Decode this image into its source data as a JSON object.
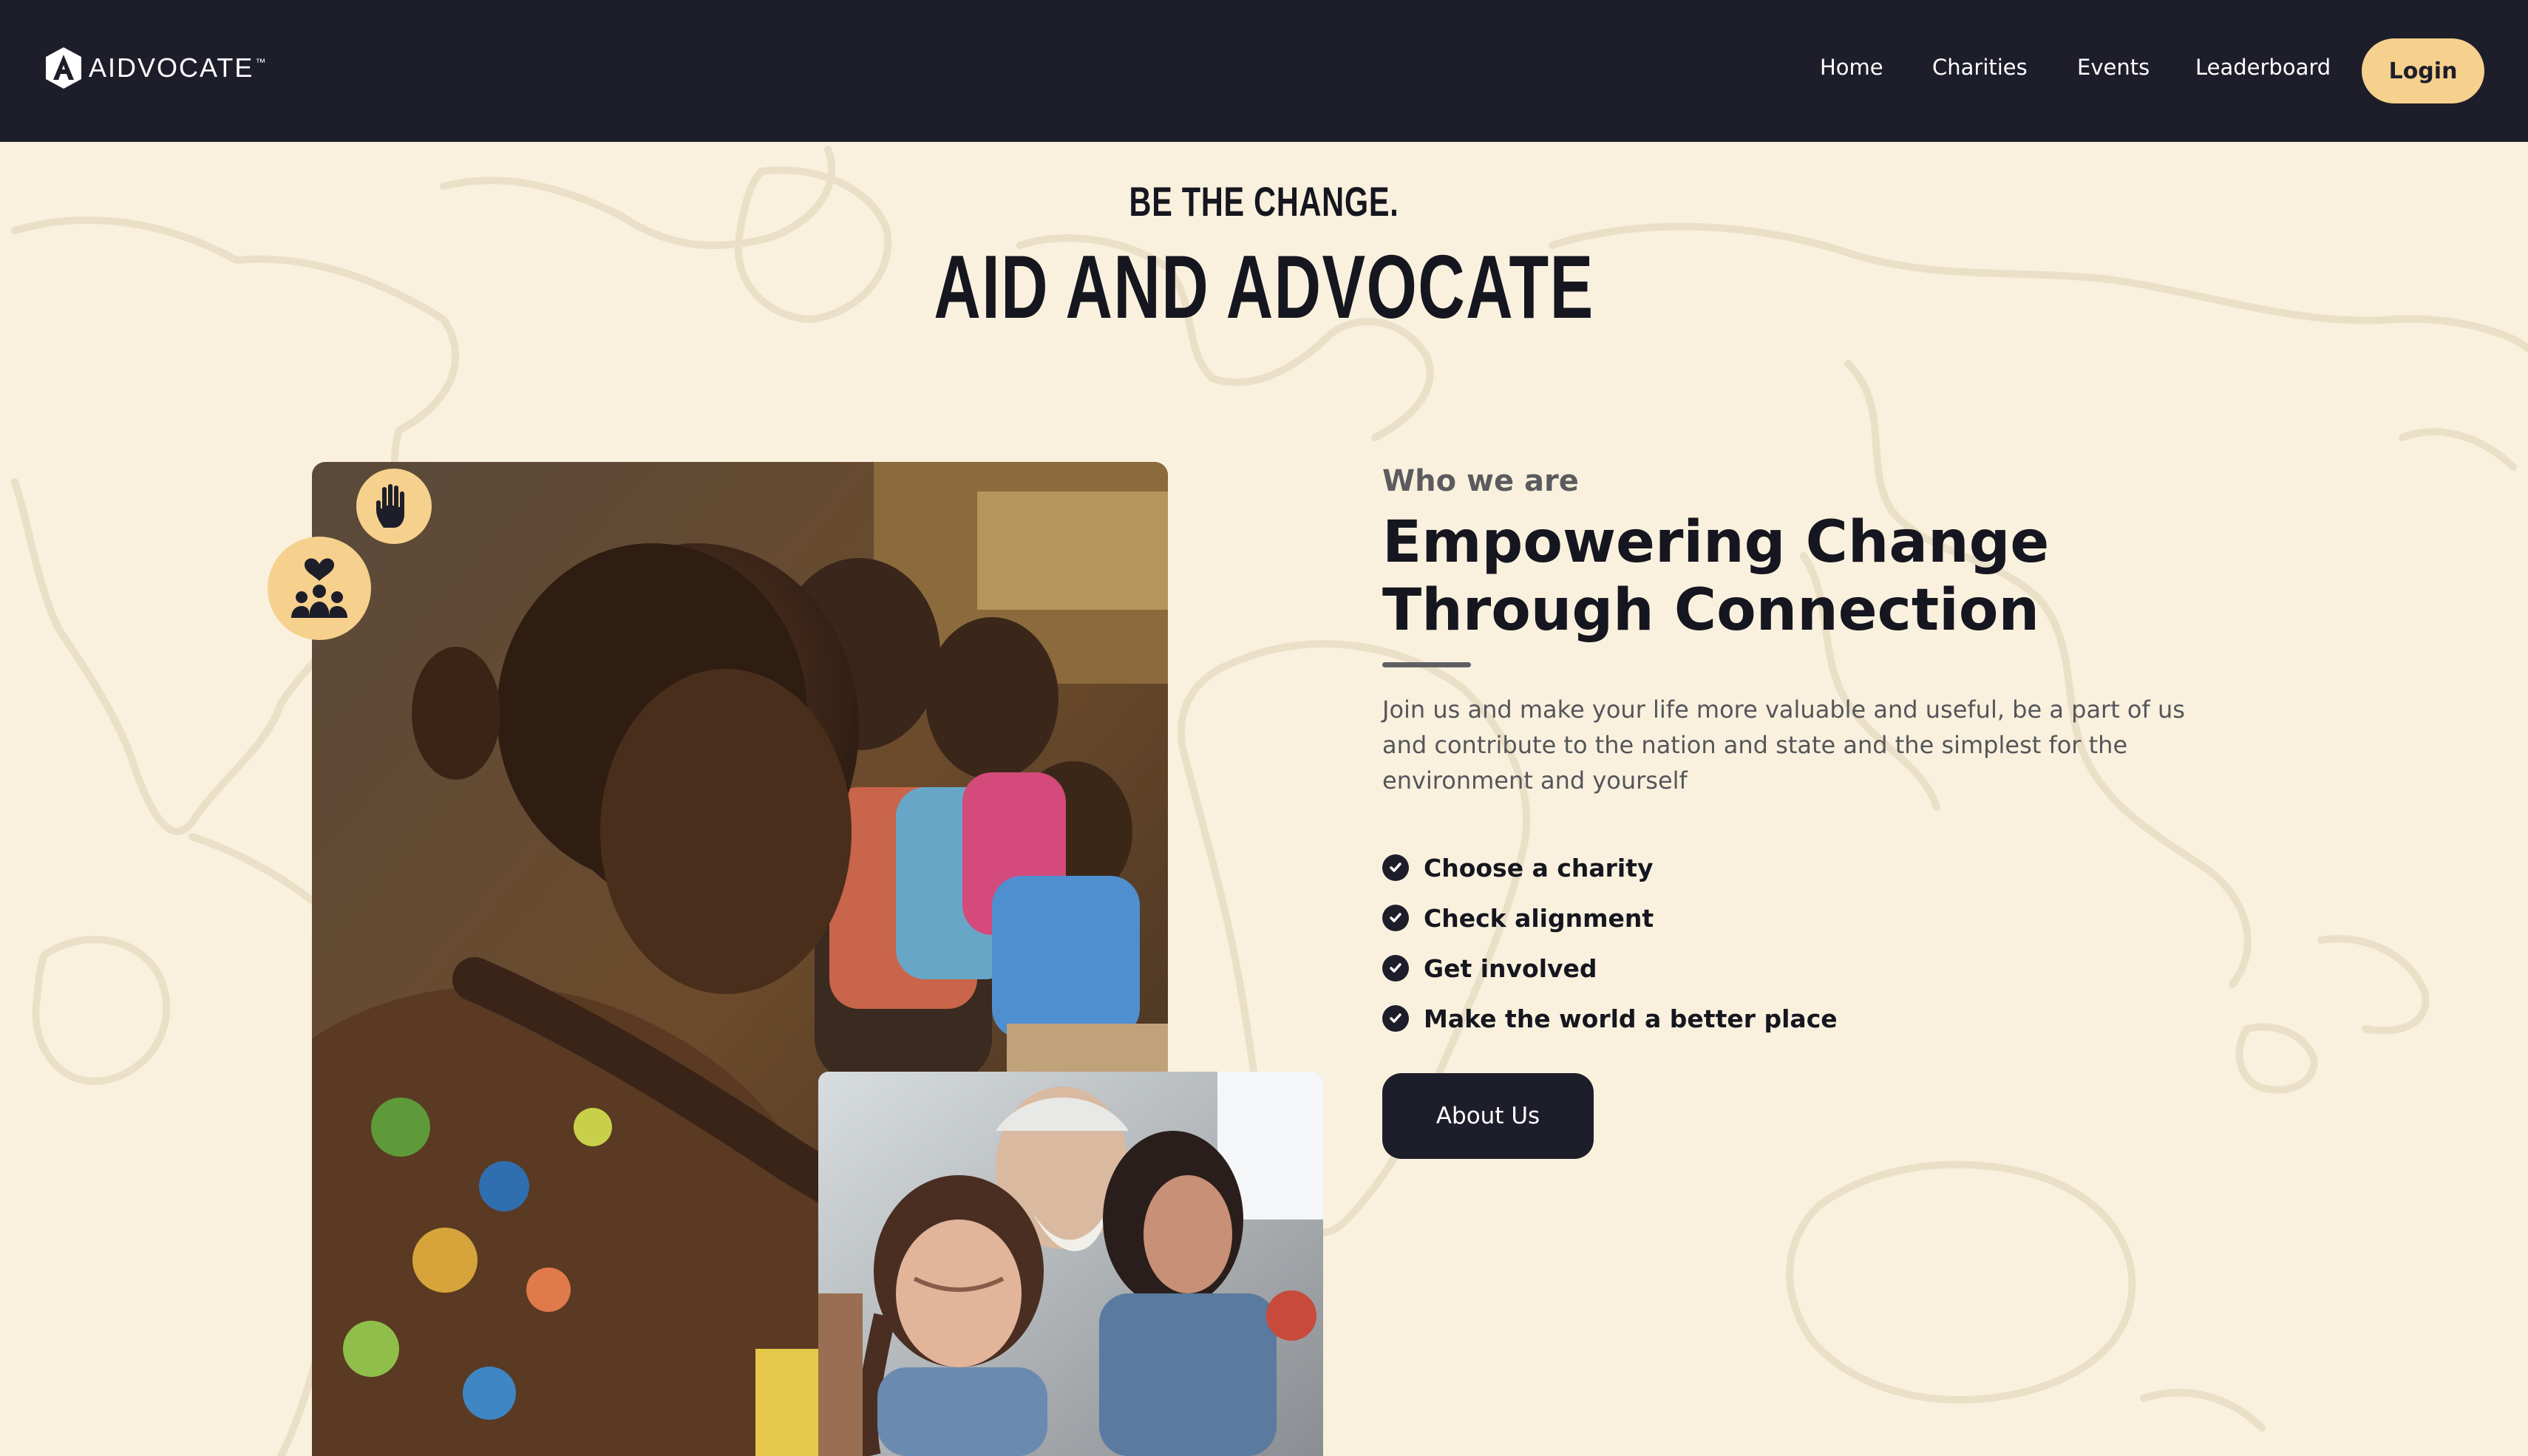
{
  "brand": {
    "name": "AIDVOCATE",
    "trademark": "™"
  },
  "nav": {
    "links": [
      "Home",
      "Charities",
      "Events",
      "Leaderboard"
    ],
    "login_label": "Login"
  },
  "hero": {
    "tagline": "BE THE CHANGE.",
    "title": "AID AND ADVOCATE"
  },
  "about": {
    "eyebrow": "Who we are",
    "headline_line1": "Empowering Change",
    "headline_line2": "Through Connection",
    "description": "Join us and make your life more valuable and useful, be a part of us and contribute to the nation and state and the simplest for the environment and yourself",
    "features": [
      "Choose a charity",
      "Check alignment",
      "Get involved",
      "Make the world a better place"
    ],
    "button_label": "About Us"
  },
  "colors": {
    "navbar": "#1d1e2a",
    "accent": "#f6d08d",
    "background": "#f9f1de",
    "text_dark": "#15161f"
  },
  "icons": {
    "logo": "aidvocate-logo-icon",
    "badge_top": "raised-hand-icon",
    "badge_left": "community-heart-icon",
    "list_bullet": "check-circle-icon"
  },
  "images": {
    "main": "child-volunteering-photo",
    "secondary": "community-volunteers-photo"
  }
}
